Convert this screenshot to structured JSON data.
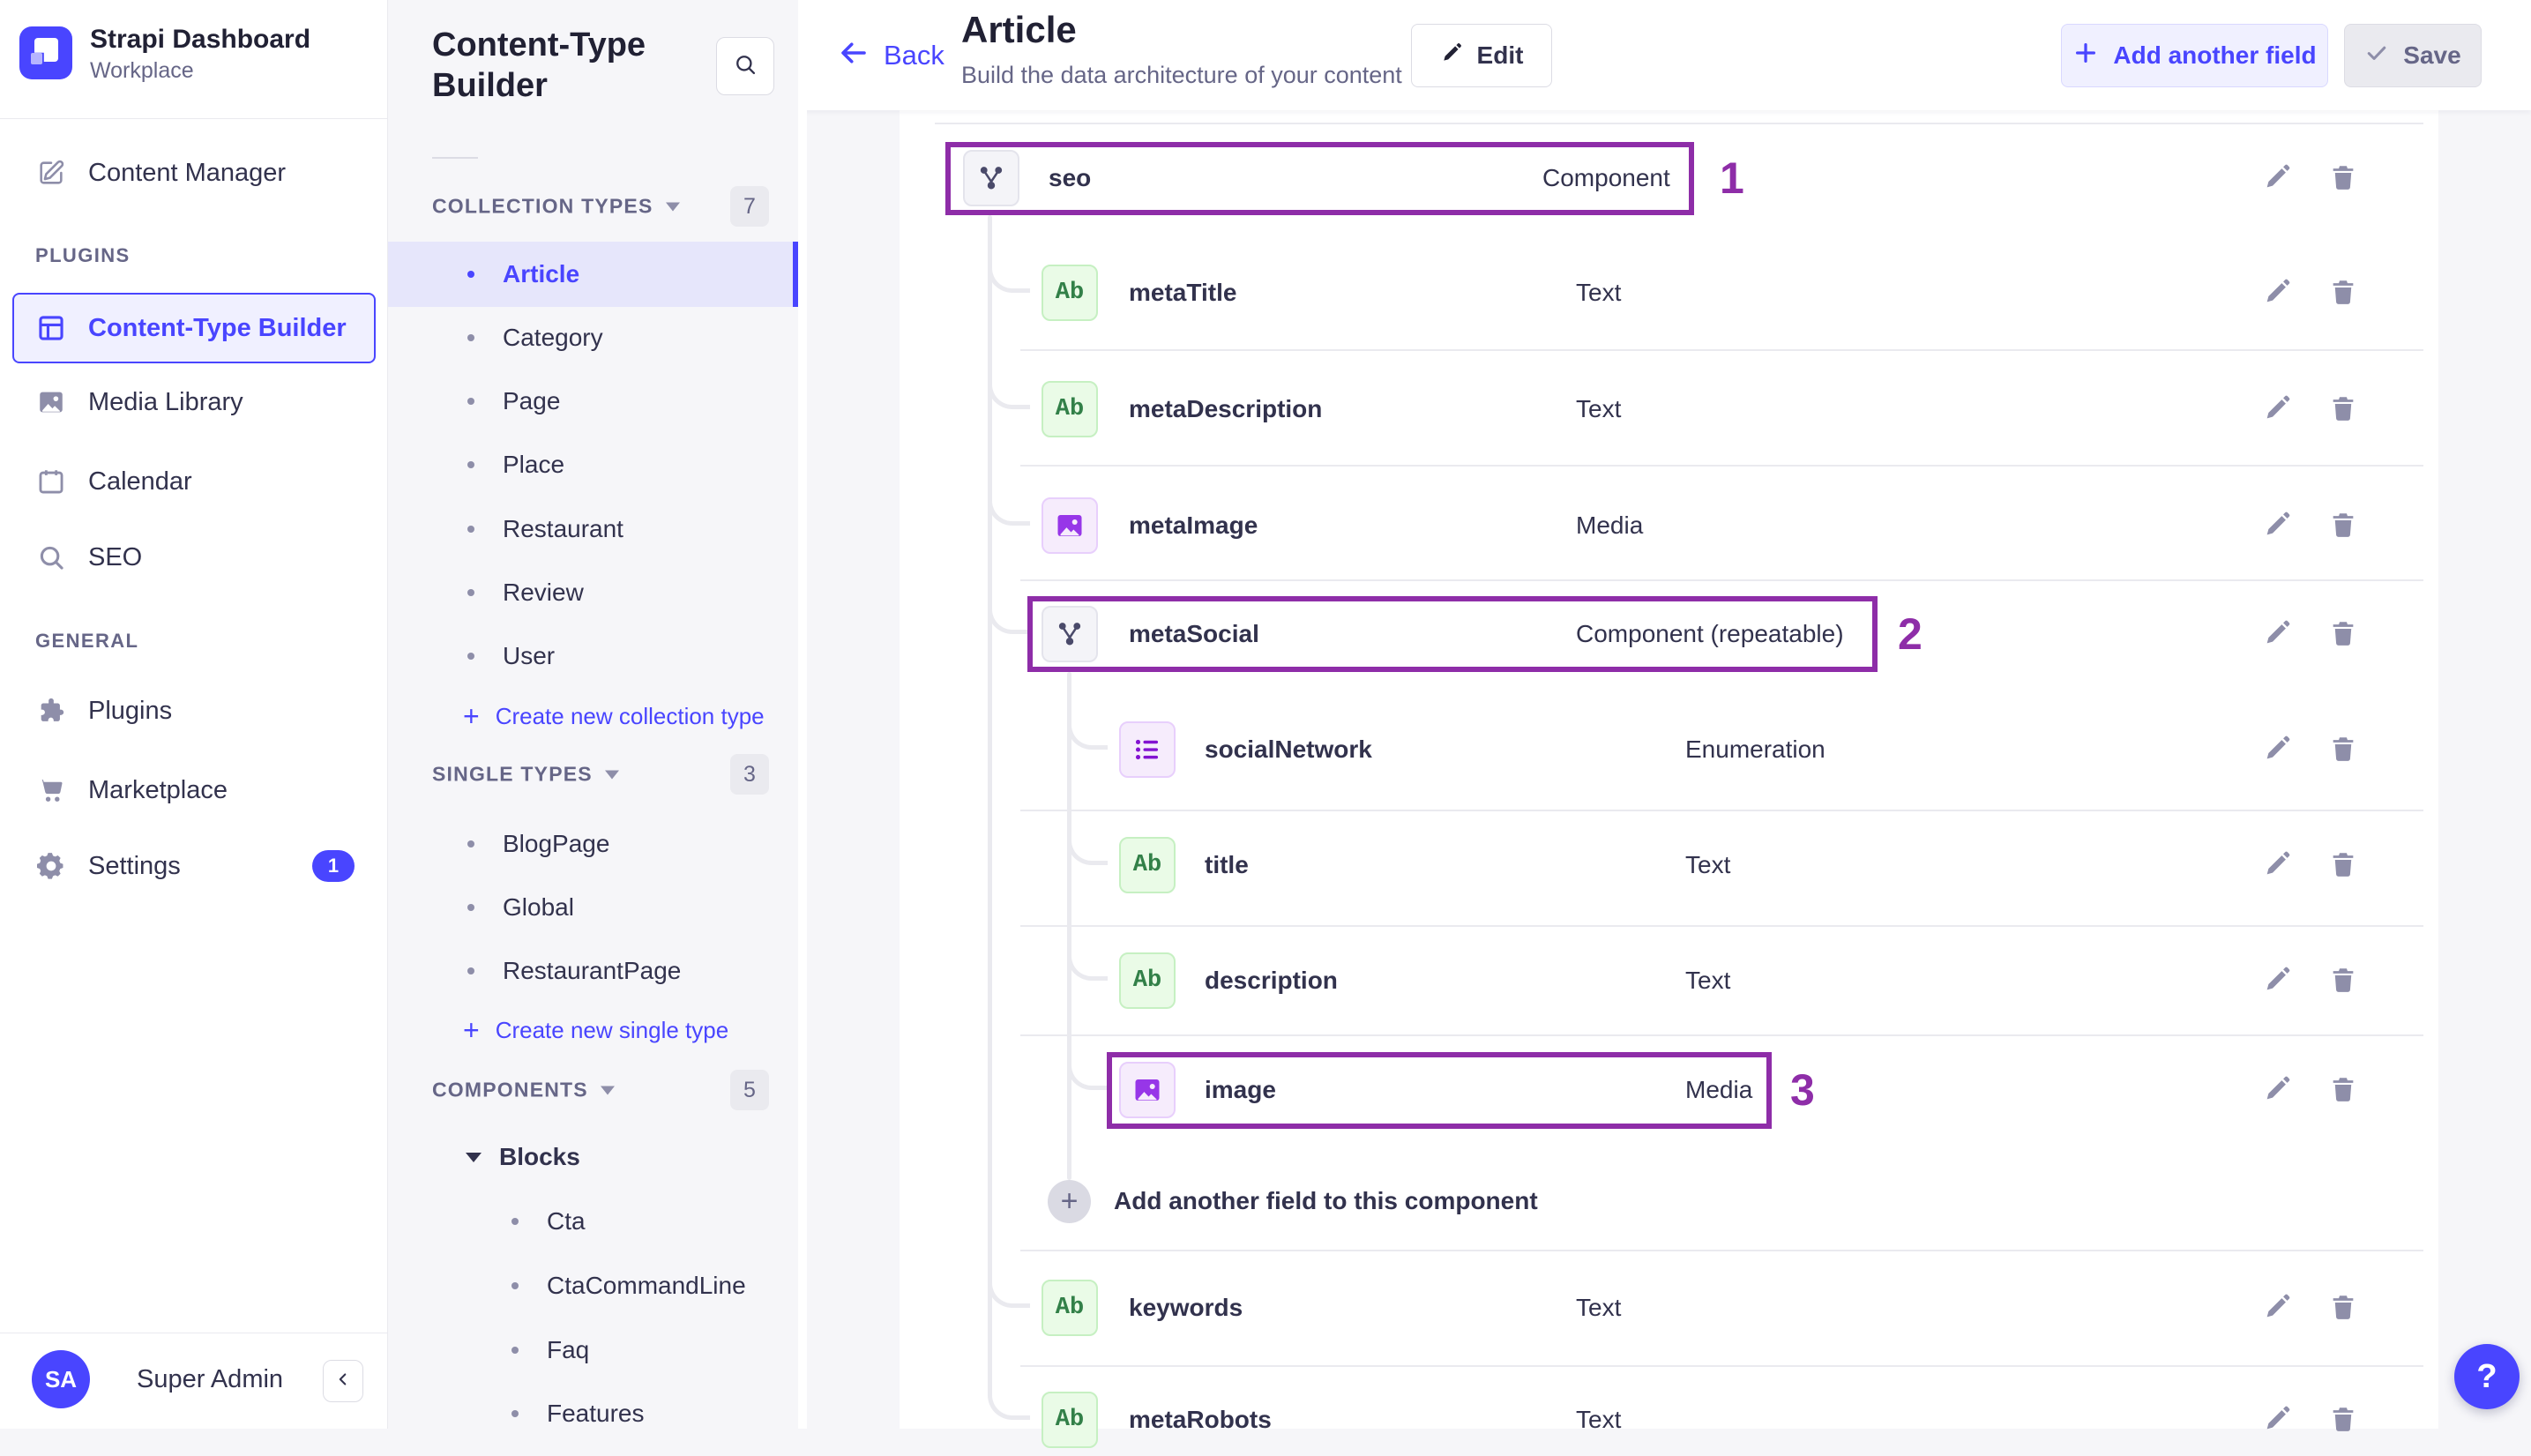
{
  "brand": {
    "app_name": "Strapi Dashboard",
    "workspace": "Workplace"
  },
  "left_nav": {
    "top_items": [
      {
        "label": "Content Manager",
        "icon": "pen-square-icon"
      }
    ],
    "sections": [
      {
        "label": "PLUGINS",
        "items": [
          {
            "label": "Content-Type Builder",
            "icon": "grid-icon",
            "active": true
          },
          {
            "label": "Media Library",
            "icon": "image-icon"
          },
          {
            "label": "Calendar",
            "icon": "calendar-icon"
          },
          {
            "label": "SEO",
            "icon": "search-icon"
          }
        ]
      },
      {
        "label": "GENERAL",
        "items": [
          {
            "label": "Plugins",
            "icon": "puzzle-icon"
          },
          {
            "label": "Marketplace",
            "icon": "cart-icon"
          },
          {
            "label": "Settings",
            "icon": "gear-icon",
            "badge": "1"
          }
        ]
      }
    ],
    "user": {
      "initials": "SA",
      "name": "Super Admin"
    }
  },
  "sub_sidebar": {
    "title": "Content-Type Builder",
    "sections": [
      {
        "label": "COLLECTION TYPES",
        "badge": "7",
        "items": [
          "Article",
          "Category",
          "Page",
          "Place",
          "Restaurant",
          "Review",
          "User"
        ],
        "active_index": 0,
        "link": "Create new collection type"
      },
      {
        "label": "SINGLE TYPES",
        "badge": "3",
        "items": [
          "BlogPage",
          "Global",
          "RestaurantPage"
        ],
        "link": "Create new single type"
      },
      {
        "label": "COMPONENTS",
        "badge": "5",
        "groups": [
          {
            "label": "Blocks",
            "items": [
              "Cta",
              "CtaCommandLine",
              "Faq",
              "Features"
            ]
          }
        ]
      }
    ]
  },
  "header": {
    "back_label": "Back",
    "title": "Article",
    "subtitle": "Build the data architecture of your content",
    "edit_label": "Edit",
    "add_field_label": "Add another field",
    "save_label": "Save"
  },
  "fields_table": {
    "rows": [
      {
        "name": "seo",
        "type": "Component",
        "icon": "component",
        "level": 0,
        "annotation": "1"
      },
      {
        "name": "metaTitle",
        "type": "Text",
        "icon": "text",
        "level": 1
      },
      {
        "name": "metaDescription",
        "type": "Text",
        "icon": "text",
        "level": 1
      },
      {
        "name": "metaImage",
        "type": "Media",
        "icon": "media",
        "level": 1
      },
      {
        "name": "metaSocial",
        "type": "Component (repeatable)",
        "icon": "component",
        "level": 1,
        "annotation": "2"
      },
      {
        "name": "socialNetwork",
        "type": "Enumeration",
        "icon": "enumeration",
        "level": 2
      },
      {
        "name": "title",
        "type": "Text",
        "icon": "text",
        "level": 2
      },
      {
        "name": "description",
        "type": "Text",
        "icon": "text",
        "level": 2
      },
      {
        "name": "image",
        "type": "Media",
        "icon": "media",
        "level": 2,
        "annotation": "3"
      },
      {
        "kind": "add",
        "label": "Add another field to this component"
      },
      {
        "name": "keywords",
        "type": "Text",
        "icon": "text",
        "level": 1
      },
      {
        "name": "metaRobots",
        "type": "Text",
        "icon": "text",
        "level": 1
      }
    ],
    "text_chip_label": "Ab"
  },
  "help_label": "?",
  "colors": {
    "primary": "#4945FF",
    "annotation": "#8E2DA8",
    "text_dark": "#32324D",
    "text_muted": "#666687"
  }
}
